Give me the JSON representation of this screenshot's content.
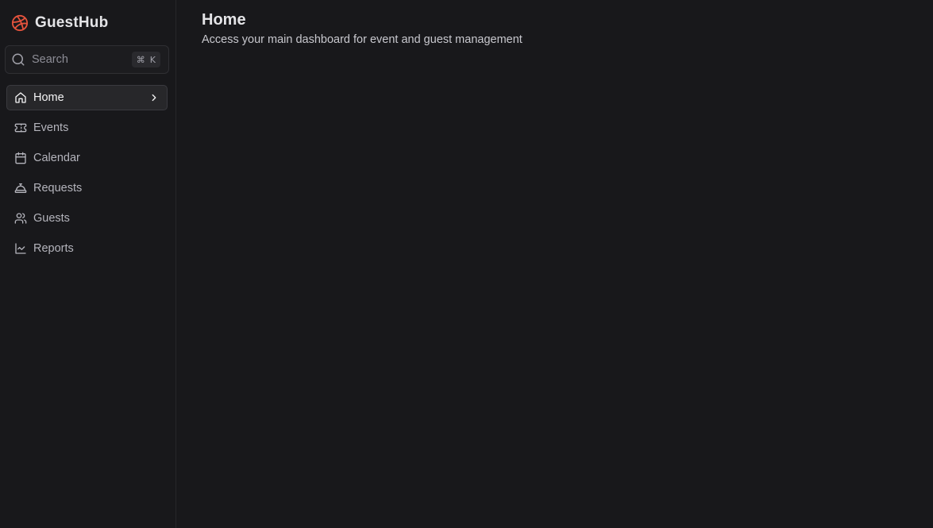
{
  "brand": {
    "name": "GuestHub",
    "logo_icon": "basketball-icon",
    "accent": "#e5533d"
  },
  "search": {
    "placeholder": "Search",
    "shortcut_symbol": "⌘",
    "shortcut_key": "K",
    "icon": "search-icon"
  },
  "nav": {
    "items": [
      {
        "id": "home",
        "label": "Home",
        "icon": "home-icon",
        "active": true
      },
      {
        "id": "events",
        "label": "Events",
        "icon": "ticket-icon",
        "active": false
      },
      {
        "id": "calendar",
        "label": "Calendar",
        "icon": "calendar-icon",
        "active": false
      },
      {
        "id": "requests",
        "label": "Requests",
        "icon": "bell-concierge-icon",
        "active": false
      },
      {
        "id": "guests",
        "label": "Guests",
        "icon": "users-icon",
        "active": false
      },
      {
        "id": "reports",
        "label": "Reports",
        "icon": "line-chart-icon",
        "active": false
      }
    ]
  },
  "main": {
    "title": "Home",
    "subtitle": "Access your main dashboard for event and guest management"
  },
  "colors": {
    "background": "#18181b",
    "sidebar_border": "#27272a",
    "active_item_bg": "#27272a",
    "text_primary": "#e4e4e7",
    "text_muted": "#b4b4bc"
  }
}
